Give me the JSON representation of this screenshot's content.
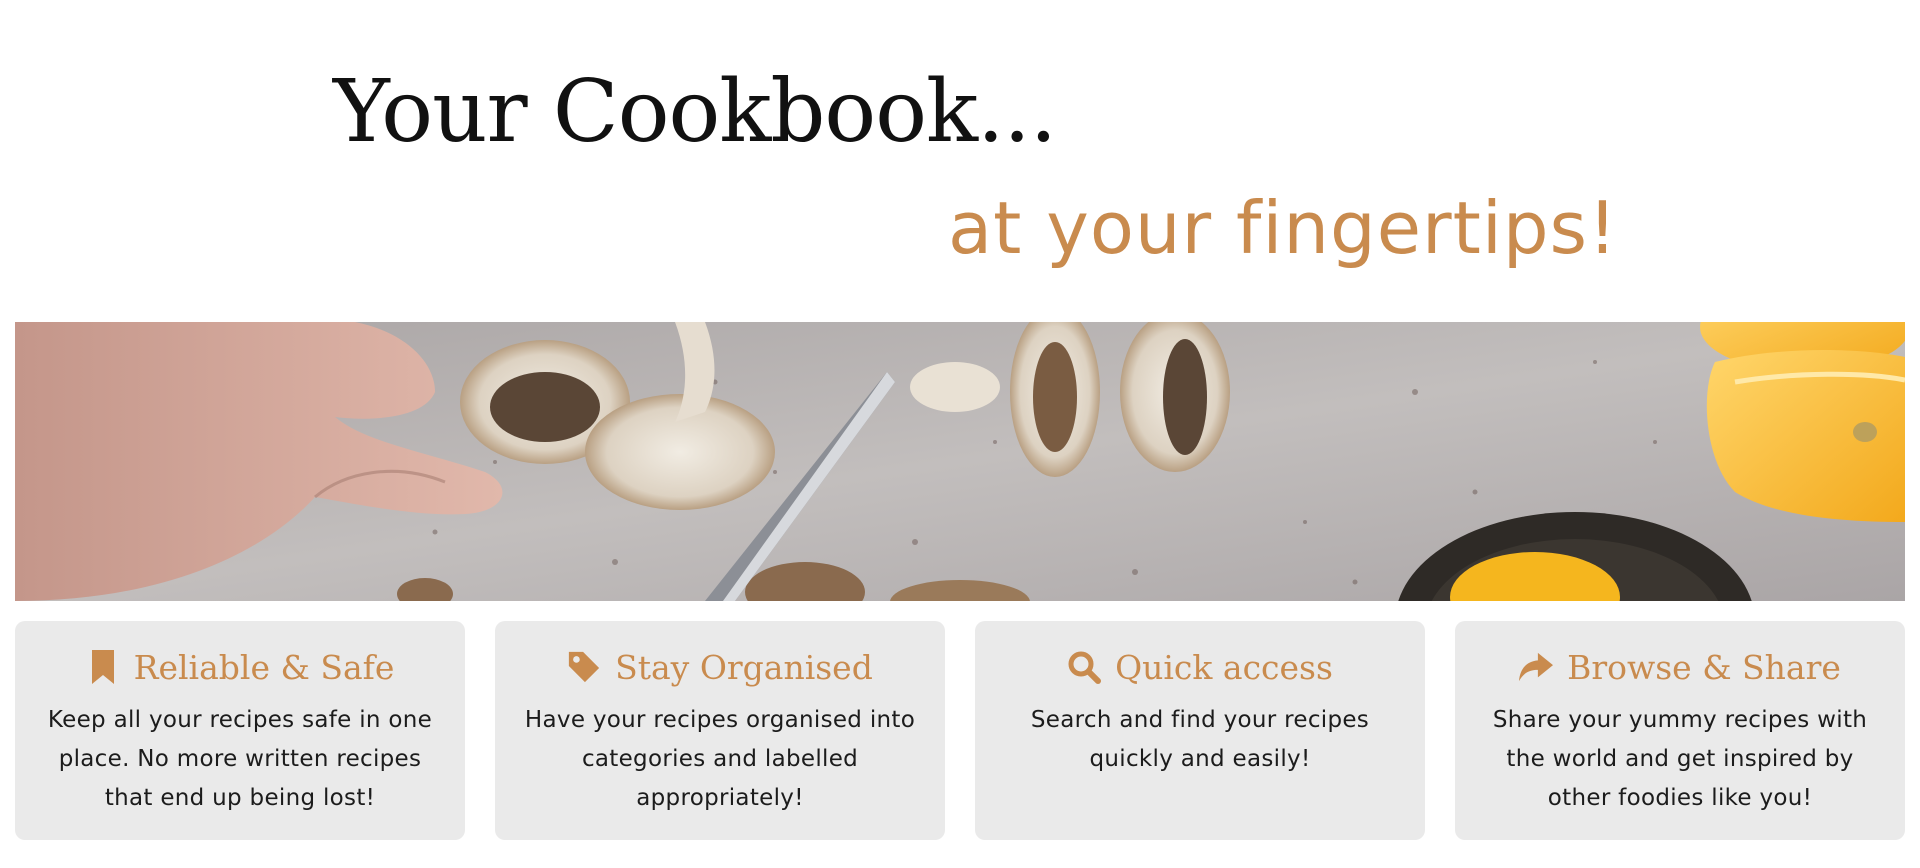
{
  "hero": {
    "title": "Your Cookbook...",
    "subtitle": "at your fingertips!"
  },
  "theme": {
    "accent": "#c98b4e",
    "card_bg": "#eaeaea",
    "text": "#111111"
  },
  "features": [
    {
      "icon": "bookmark-icon",
      "title": "Reliable & Safe",
      "text": "Keep all your recipes safe in one place. No more written recipes that end up being lost!"
    },
    {
      "icon": "tag-icon",
      "title": "Stay Organised",
      "text": "Have your recipes organised into categories and labelled appropriately!"
    },
    {
      "icon": "search-icon",
      "title": "Quick access",
      "text": "Search and find your recipes quickly and easily!"
    },
    {
      "icon": "share-icon",
      "title": "Browse & Share",
      "text": "Share your yummy recipes with the world and get inspired by other foodies like you!"
    }
  ]
}
